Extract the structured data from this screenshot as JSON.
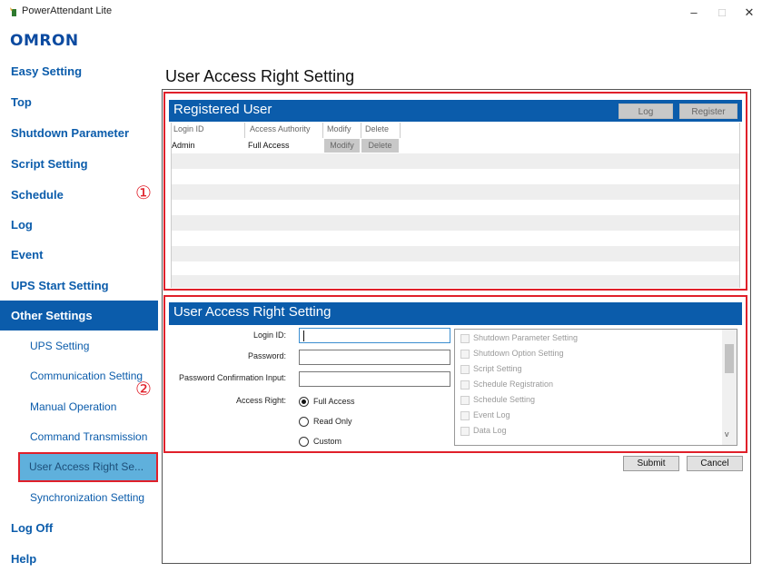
{
  "window": {
    "title": "PowerAttendant Lite",
    "min_glyph": "–",
    "max_glyph": "□",
    "close_glyph": "✕"
  },
  "logo": "OMRON",
  "sidebar": {
    "items": [
      {
        "label": "Easy Setting"
      },
      {
        "label": "Top"
      },
      {
        "label": "Shutdown Parameter"
      },
      {
        "label": "Script Setting"
      },
      {
        "label": "Schedule"
      },
      {
        "label": "Log"
      },
      {
        "label": "Event"
      },
      {
        "label": "UPS Start Setting"
      },
      {
        "label": "Other Settings"
      },
      {
        "label": "Log Off"
      },
      {
        "label": "Help"
      }
    ],
    "sub_items": [
      {
        "label": "UPS Setting"
      },
      {
        "label": "Communication Setting"
      },
      {
        "label": "Manual Operation"
      },
      {
        "label": "Command Transmission"
      },
      {
        "label": "User Access Right Se..."
      },
      {
        "label": "Synchronization Setting"
      }
    ]
  },
  "page_title": "User Access Right Setting",
  "registered_panel": {
    "title": "Registered User",
    "log_button": "Log",
    "register_button": "Register",
    "columns": [
      "Login ID",
      "Access Authority",
      "Modify",
      "Delete"
    ],
    "rows": [
      {
        "login_id": "Admin",
        "authority": "Full Access",
        "modify": "Modify",
        "delete": "Delete"
      }
    ]
  },
  "annotations": {
    "marker_1": "①",
    "marker_2": "②"
  },
  "access_panel": {
    "title": "User Access Right Setting",
    "login_id_label": "Login ID:",
    "password_label": "Password:",
    "confirm_label": "Password Confirmation Input:",
    "access_right_label": "Access Right:",
    "login_id_value": "",
    "password_value": "",
    "confirm_value": "",
    "options": [
      "Full Access",
      "Read Only",
      "Custom"
    ],
    "selected_option": "Full Access",
    "permissions": [
      "Shutdown Parameter Setting",
      "Shutdown Option Setting",
      "Script Setting",
      "Schedule Registration",
      "Schedule Setting",
      "Event Log",
      "Data Log"
    ],
    "scroll_up_glyph": "^",
    "scroll_down_glyph": "v"
  },
  "actions": {
    "submit": "Submit",
    "cancel": "Cancel"
  },
  "colors": {
    "accent": "#0b5cab",
    "selected": "#5fb0dc",
    "highlight_red": "#e0202a"
  }
}
